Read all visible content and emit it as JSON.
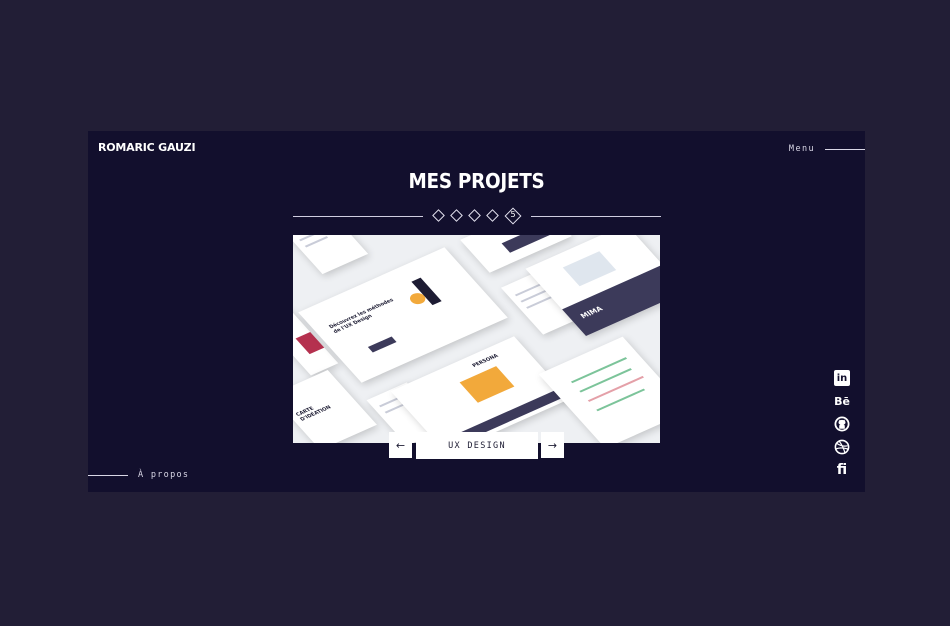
{
  "header": {
    "brand": "ROMARIC GAUZI",
    "menu_label": "Menu"
  },
  "main": {
    "title": "MES PROJETS",
    "pager": {
      "active_number": "5",
      "total": 5
    },
    "project": {
      "label": "UX DESIGN",
      "preview_texts": {
        "headline": "Découvrez les méthodes de l'UX Design",
        "persona": "PERSONA",
        "carte": "CARTE D'IDÉATION",
        "mima": "MIMA"
      }
    }
  },
  "footer": {
    "about_label": "À propos"
  },
  "social": {
    "icons": [
      "linkedin-icon",
      "behance-icon",
      "github-icon",
      "dribbble-icon",
      "freelance-icon"
    ],
    "linkedin_glyph": "in",
    "behance_glyph": "Bē",
    "freelance_glyph": "fi"
  },
  "colors": {
    "page_background": "#221e36",
    "panel_background": "#120f2d",
    "text": "#ffffff",
    "accent_yellow": "#f2a93b"
  }
}
